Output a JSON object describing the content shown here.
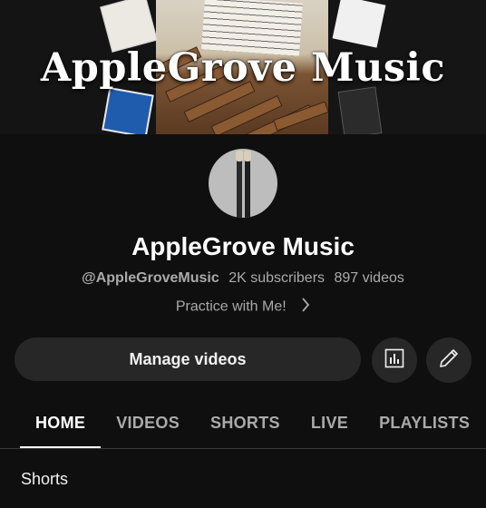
{
  "banner": {
    "title": "AppleGrove Music"
  },
  "channel": {
    "name": "AppleGrove Music",
    "handle": "@AppleGroveMusic",
    "subscribers": "2K subscribers",
    "videos": "897 videos",
    "tagline": "Practice with Me!"
  },
  "actions": {
    "manage_videos": "Manage videos",
    "analytics_icon": "bar-chart-icon",
    "edit_icon": "pencil-icon"
  },
  "tabs": [
    "HOME",
    "VIDEOS",
    "SHORTS",
    "LIVE",
    "PLAYLISTS"
  ],
  "active_tab": "HOME",
  "section": {
    "title": "Shorts"
  }
}
